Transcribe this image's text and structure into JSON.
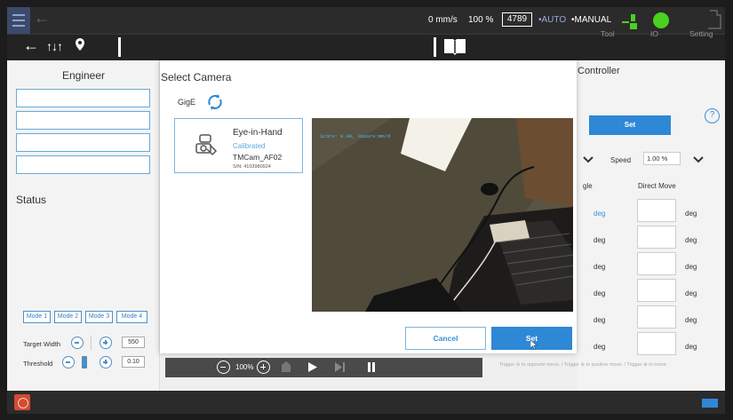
{
  "topbar": {
    "speed": "0 mm/s",
    "percent": "100 %",
    "power": "4789",
    "auto": "•AUTO",
    "manual": "•MANUAL"
  },
  "left_panel": {
    "title": "Engineer",
    "status_label": "Status",
    "modes": [
      "Mode 1",
      "Mode 2",
      "Mode 3",
      "Mode 4"
    ],
    "target_width_label": "Target Width",
    "target_width_value": "550",
    "threshold_label": "Threshold",
    "threshold_value": "0.10"
  },
  "modal": {
    "title": "Select Camera",
    "interface": "GigE",
    "camera": {
      "name": "Eye-in-Hand",
      "status": "Calibrated",
      "model": "TMCam_AF02",
      "serial": "S/N: 4103980924"
    },
    "overlay": "Score: 0.00, Square:mm/d",
    "cancel_label": "Cancel",
    "set_label": "Set"
  },
  "player": {
    "zoom": "100%"
  },
  "right_panel": {
    "title": "Controller",
    "tabs": [
      "Tool",
      "IO",
      "Setting"
    ],
    "set_label": "Set",
    "speed_label": "Speed",
    "speed_value": "1.00 %",
    "col_angle": "gle",
    "col_direct": "Direct Move",
    "unit": "deg",
    "hint": "Trigger ⊖ to opposite move. / Trigger ⊕ to positive move. / Trigger ⊕ to move."
  },
  "colors": {
    "accent": "#2e88d6",
    "led": "#4bd11f",
    "error": "#d14b32"
  }
}
